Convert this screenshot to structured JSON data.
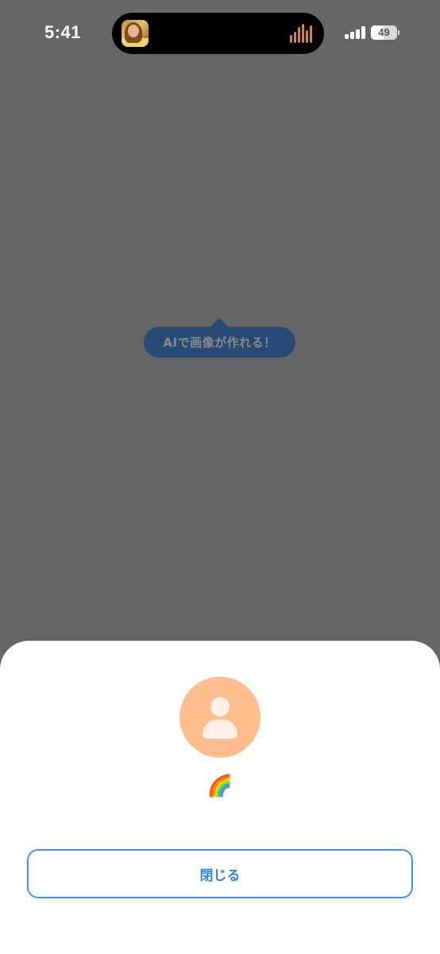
{
  "status_bar": {
    "time": "5:41",
    "battery_level": "49",
    "now_playing_icon": "album-art-thumbnail",
    "waveform_color": "#c8874f"
  },
  "tooltip": {
    "text": "AIで画像が作れる！",
    "background": "#264a75"
  },
  "profile_sheet": {
    "avatar_icon": "person-icon",
    "avatar_color": "#ffbd8e",
    "user_name": "🌈",
    "close_label": "閉じる",
    "accent_color": "#3f94e8"
  },
  "overlay_color": "#666666"
}
